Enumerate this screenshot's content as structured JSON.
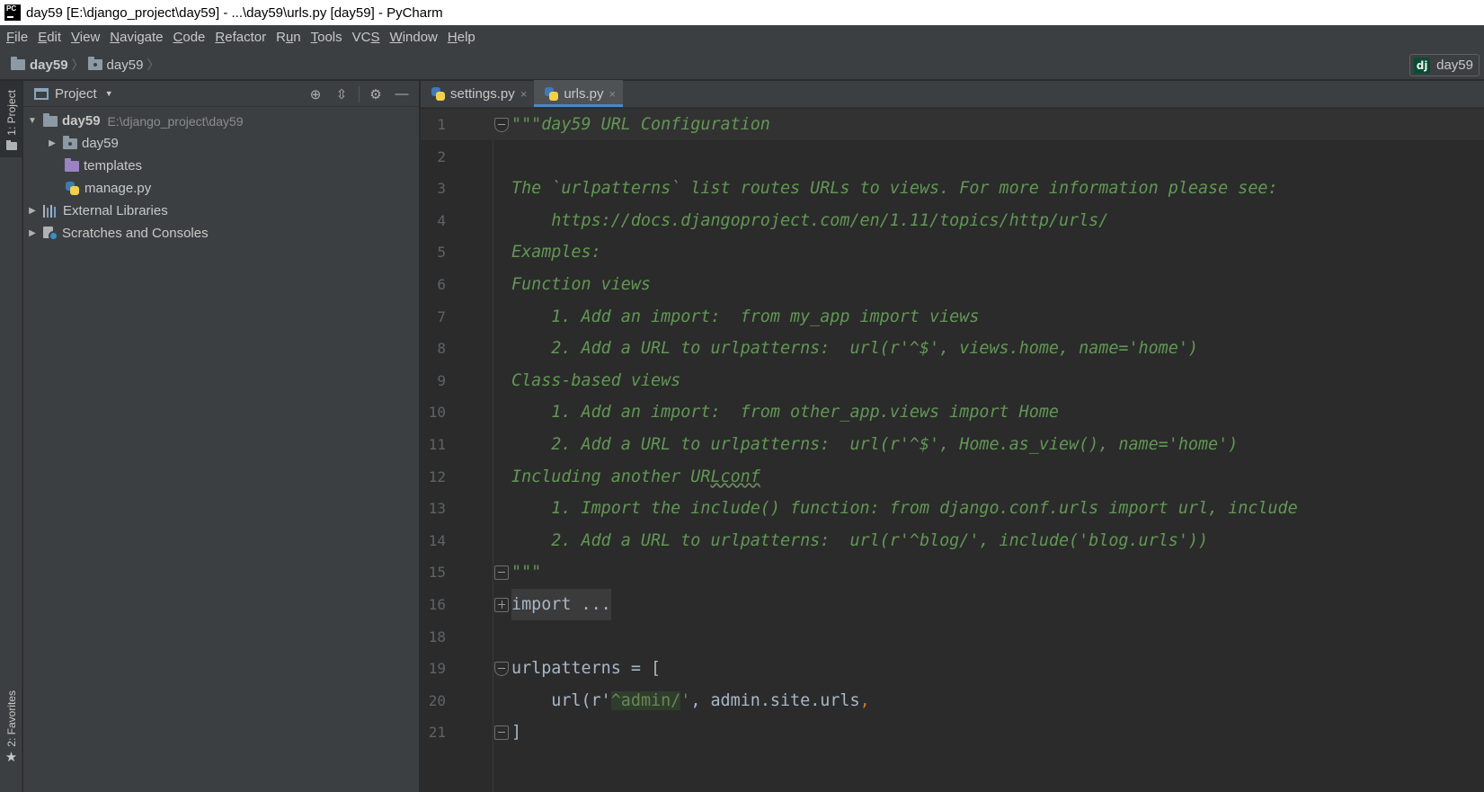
{
  "window": {
    "title": "day59 [E:\\django_project\\day59] - ...\\day59\\urls.py [day59] - PyCharm"
  },
  "menu": [
    {
      "pre": "",
      "mn": "F",
      "post": "ile"
    },
    {
      "pre": "",
      "mn": "E",
      "post": "dit"
    },
    {
      "pre": "",
      "mn": "V",
      "post": "iew"
    },
    {
      "pre": "",
      "mn": "N",
      "post": "avigate"
    },
    {
      "pre": "",
      "mn": "C",
      "post": "ode"
    },
    {
      "pre": "",
      "mn": "R",
      "post": "efactor"
    },
    {
      "pre": "R",
      "mn": "u",
      "post": "n"
    },
    {
      "pre": "",
      "mn": "T",
      "post": "ools"
    },
    {
      "pre": "VC",
      "mn": "S",
      "post": ""
    },
    {
      "pre": "",
      "mn": "W",
      "post": "indow"
    },
    {
      "pre": "",
      "mn": "H",
      "post": "elp"
    }
  ],
  "breadcrumb": [
    "day59",
    "day59"
  ],
  "run_config": {
    "icon_text": "dj",
    "label": "day59"
  },
  "left_strip": {
    "project": "1: Project",
    "favorites": "2: Favorites"
  },
  "project_panel": {
    "title": "Project",
    "tree": {
      "root": {
        "name": "day59",
        "path": "E:\\django_project\\day59"
      },
      "children": [
        "day59",
        "templates",
        "manage.py"
      ],
      "external": "External Libraries",
      "scratches": "Scratches and Consoles"
    }
  },
  "tabs": [
    {
      "label": "settings.py",
      "close": "×"
    },
    {
      "label": "urls.py",
      "close": "×"
    }
  ],
  "code": {
    "lines": [
      {
        "n": "1",
        "t": "\"\"\"day59 URL Configuration"
      },
      {
        "n": "2",
        "t": ""
      },
      {
        "n": "3",
        "t": "The `urlpatterns` list routes URLs to views. For more information please see:"
      },
      {
        "n": "4",
        "t": "    https://docs.djangoproject.com/en/1.11/topics/http/urls/"
      },
      {
        "n": "5",
        "t": "Examples:"
      },
      {
        "n": "6",
        "t": "Function views"
      },
      {
        "n": "7",
        "t": "    1. Add an import:  from my_app import views"
      },
      {
        "n": "8",
        "t": "    2. Add a URL to urlpatterns:  url(r'^$', views.home, name='home')"
      },
      {
        "n": "9",
        "t": "Class-based views"
      },
      {
        "n": "10",
        "t": "    1. Add an import:  from other_app.views import Home"
      },
      {
        "n": "11",
        "t": "    2. Add a URL to urlpatterns:  url(r'^$', Home.as_view(), name='home')"
      },
      {
        "n": "12",
        "pre": "Including another UR",
        "wavy": "Lconf"
      },
      {
        "n": "13",
        "t": "    1. Import the include() function: from django.conf.urls import url, include"
      },
      {
        "n": "14",
        "t": "    2. Add a URL to urlpatterns:  url(r'^blog/', include('blog.urls'))"
      },
      {
        "n": "15",
        "t": "\"\"\""
      },
      {
        "n": "16",
        "t": "import ..."
      },
      {
        "n": "18",
        "t": ""
      },
      {
        "n": "19",
        "t": "urlpatterns = ["
      },
      {
        "n": "20",
        "a": "    url(r'",
        "b": "^admin/",
        "c": "'",
        "d": ", admin.site.urls",
        "e": ","
      },
      {
        "n": "21",
        "t": "]"
      }
    ]
  }
}
